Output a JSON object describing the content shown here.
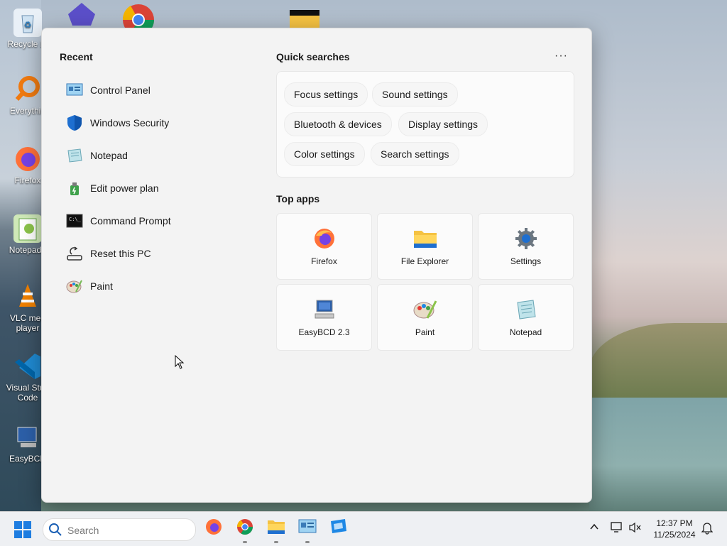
{
  "desktop": {
    "icons": [
      {
        "label": "Recycle Bi"
      },
      {
        "label": "Everythin"
      },
      {
        "label": "Firefox"
      },
      {
        "label": "Notepad+"
      },
      {
        "label": "VLC med player"
      },
      {
        "label": "Visual Stud Code"
      },
      {
        "label": "EasyBCD"
      }
    ]
  },
  "start": {
    "recent_title": "Recent",
    "recent": [
      {
        "label": "Control Panel",
        "icon": "control-panel-icon"
      },
      {
        "label": "Windows Security",
        "icon": "shield-icon"
      },
      {
        "label": "Notepad",
        "icon": "notepad-icon"
      },
      {
        "label": "Edit power plan",
        "icon": "power-plan-icon"
      },
      {
        "label": "Command Prompt",
        "icon": "terminal-icon"
      },
      {
        "label": "Reset this PC",
        "icon": "reset-icon"
      },
      {
        "label": "Paint",
        "icon": "paint-icon"
      }
    ],
    "quick_title": "Quick searches",
    "more": "···",
    "quick": [
      "Focus settings",
      "Sound settings",
      "Bluetooth & devices",
      "Display settings",
      "Color settings",
      "Search settings"
    ],
    "apps_title": "Top apps",
    "apps": [
      {
        "label": "Firefox",
        "icon": "firefox-icon"
      },
      {
        "label": "File Explorer",
        "icon": "folder-icon"
      },
      {
        "label": "Settings",
        "icon": "gear-icon"
      },
      {
        "label": "EasyBCD 2.3",
        "icon": "easybcd-icon"
      },
      {
        "label": "Paint",
        "icon": "paint-icon"
      },
      {
        "label": "Notepad",
        "icon": "notepad-icon"
      }
    ]
  },
  "taskbar": {
    "search_placeholder": "Search",
    "time": "12:37 PM",
    "date": "11/25/2024"
  },
  "colors": {
    "accent": "#0067c0",
    "panel_bg": "#f3f3f3",
    "taskbar_bg": "#eef0f3"
  }
}
